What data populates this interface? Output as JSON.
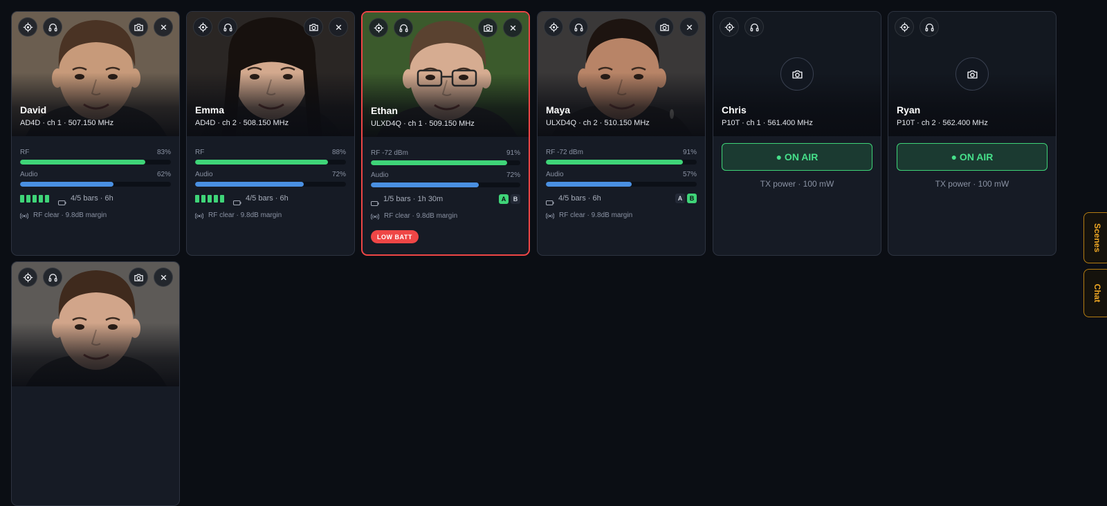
{
  "cards": [
    {
      "id": "david",
      "name": "David",
      "sub": "AD4D · ch 1 · 507.150 MHz",
      "photo": "portrait",
      "face": {
        "skin": "#c79a7a",
        "hair": "#4a3324",
        "bg": "#6b5e50",
        "shirt": "#2c2a28",
        "hairStyle": "short"
      },
      "rf_label": "RF",
      "rf_value": 0.83,
      "rf_pct": "83%",
      "audio_label": "Audio",
      "audio_value": 0.62,
      "audio_pct": "62%",
      "battery_segments": 5,
      "battery_text": "4/5 bars · 6h",
      "ab": null,
      "rf_status": "RF clear · 9.8dB margin",
      "low_batt": null,
      "alert": false
    },
    {
      "id": "emma",
      "name": "Emma",
      "sub": "AD4D · ch 2 · 508.150 MHz",
      "photo": "portrait",
      "face": {
        "skin": "#d3a98e",
        "hair": "#17110e",
        "bg": "#2a2624",
        "shirt": "#1f1c1c",
        "hairStyle": "long"
      },
      "rf_label": "RF",
      "rf_value": 0.88,
      "rf_pct": "88%",
      "audio_label": "Audio",
      "audio_value": 0.72,
      "audio_pct": "72%",
      "battery_segments": 5,
      "battery_text": "4/5 bars · 6h",
      "ab": null,
      "rf_status": "RF clear · 9.8dB margin",
      "low_batt": null,
      "alert": false
    },
    {
      "id": "ethan",
      "name": "Ethan",
      "sub": "ULXD4Q · ch 1 · 509.150 MHz",
      "photo": "portrait",
      "face": {
        "skin": "#d6ac91",
        "hair": "#5a4230",
        "bg": "#3b5a2c",
        "shirt": "#2b2c2a",
        "hairStyle": "short",
        "glasses": true
      },
      "rf_label": "RF -72 dBm",
      "rf_value": 0.91,
      "rf_pct": "91%",
      "audio_label": "Audio",
      "audio_value": 0.72,
      "audio_pct": "72%",
      "battery_segments": 0,
      "battery_text": "1/5 bars · 1h 30m",
      "ab": {
        "a": "A",
        "b": "B",
        "active": "a"
      },
      "rf_status": "RF clear · 9.8dB margin",
      "low_batt": "LOW BATT",
      "alert": true
    },
    {
      "id": "maya",
      "name": "Maya",
      "sub": "ULXD4Q · ch 2 · 510.150 MHz",
      "photo": "portrait",
      "face": {
        "skin": "#b88467",
        "hair": "#1d1410",
        "bg": "#3a3838",
        "shirt": "#262322",
        "hairStyle": "bun",
        "earring": true
      },
      "rf_label": "RF -72 dBm",
      "rf_value": 0.91,
      "rf_pct": "91%",
      "audio_label": "Audio",
      "audio_value": 0.57,
      "audio_pct": "57%",
      "battery_segments": 0,
      "battery_text": "4/5 bars · 6h",
      "ab": {
        "a": "A",
        "b": "B",
        "active": "b"
      },
      "rf_status": "RF clear · 9.8dB margin",
      "low_batt": null,
      "alert": false
    },
    {
      "id": "chris",
      "name": "Chris",
      "sub": "P10T · ch 1 · 561.400 MHz",
      "photo": "empty",
      "on_air": "● ON AIR",
      "tx_power": "TX power · 100 mW"
    },
    {
      "id": "ryan",
      "name": "Ryan",
      "sub": "P10T · ch 2 · 562.400 MHz",
      "photo": "empty",
      "on_air": "● ON AIR",
      "tx_power": "TX power · 100 mW"
    },
    {
      "id": "partial",
      "name": "",
      "sub": "",
      "photo": "portrait",
      "face": {
        "skin": "#d1a58a",
        "hair": "#3f2a1d",
        "bg": "#5d5a57",
        "shirt": "#2a2a2a",
        "hairStyle": "short"
      },
      "partial": true
    }
  ],
  "icons": {
    "target": "crosshair-icon",
    "listen": "headphones-icon",
    "snapshot": "camera-icon",
    "close": "close-icon",
    "battery": "battery-icon",
    "rf": "antenna-icon"
  },
  "side_tabs": [
    {
      "label": "Scenes"
    },
    {
      "label": "Chat"
    }
  ],
  "colors": {
    "rf": "#3fd478",
    "audio": "#4a90e2",
    "alert": "#ef4646",
    "accent": "#f0a824"
  }
}
